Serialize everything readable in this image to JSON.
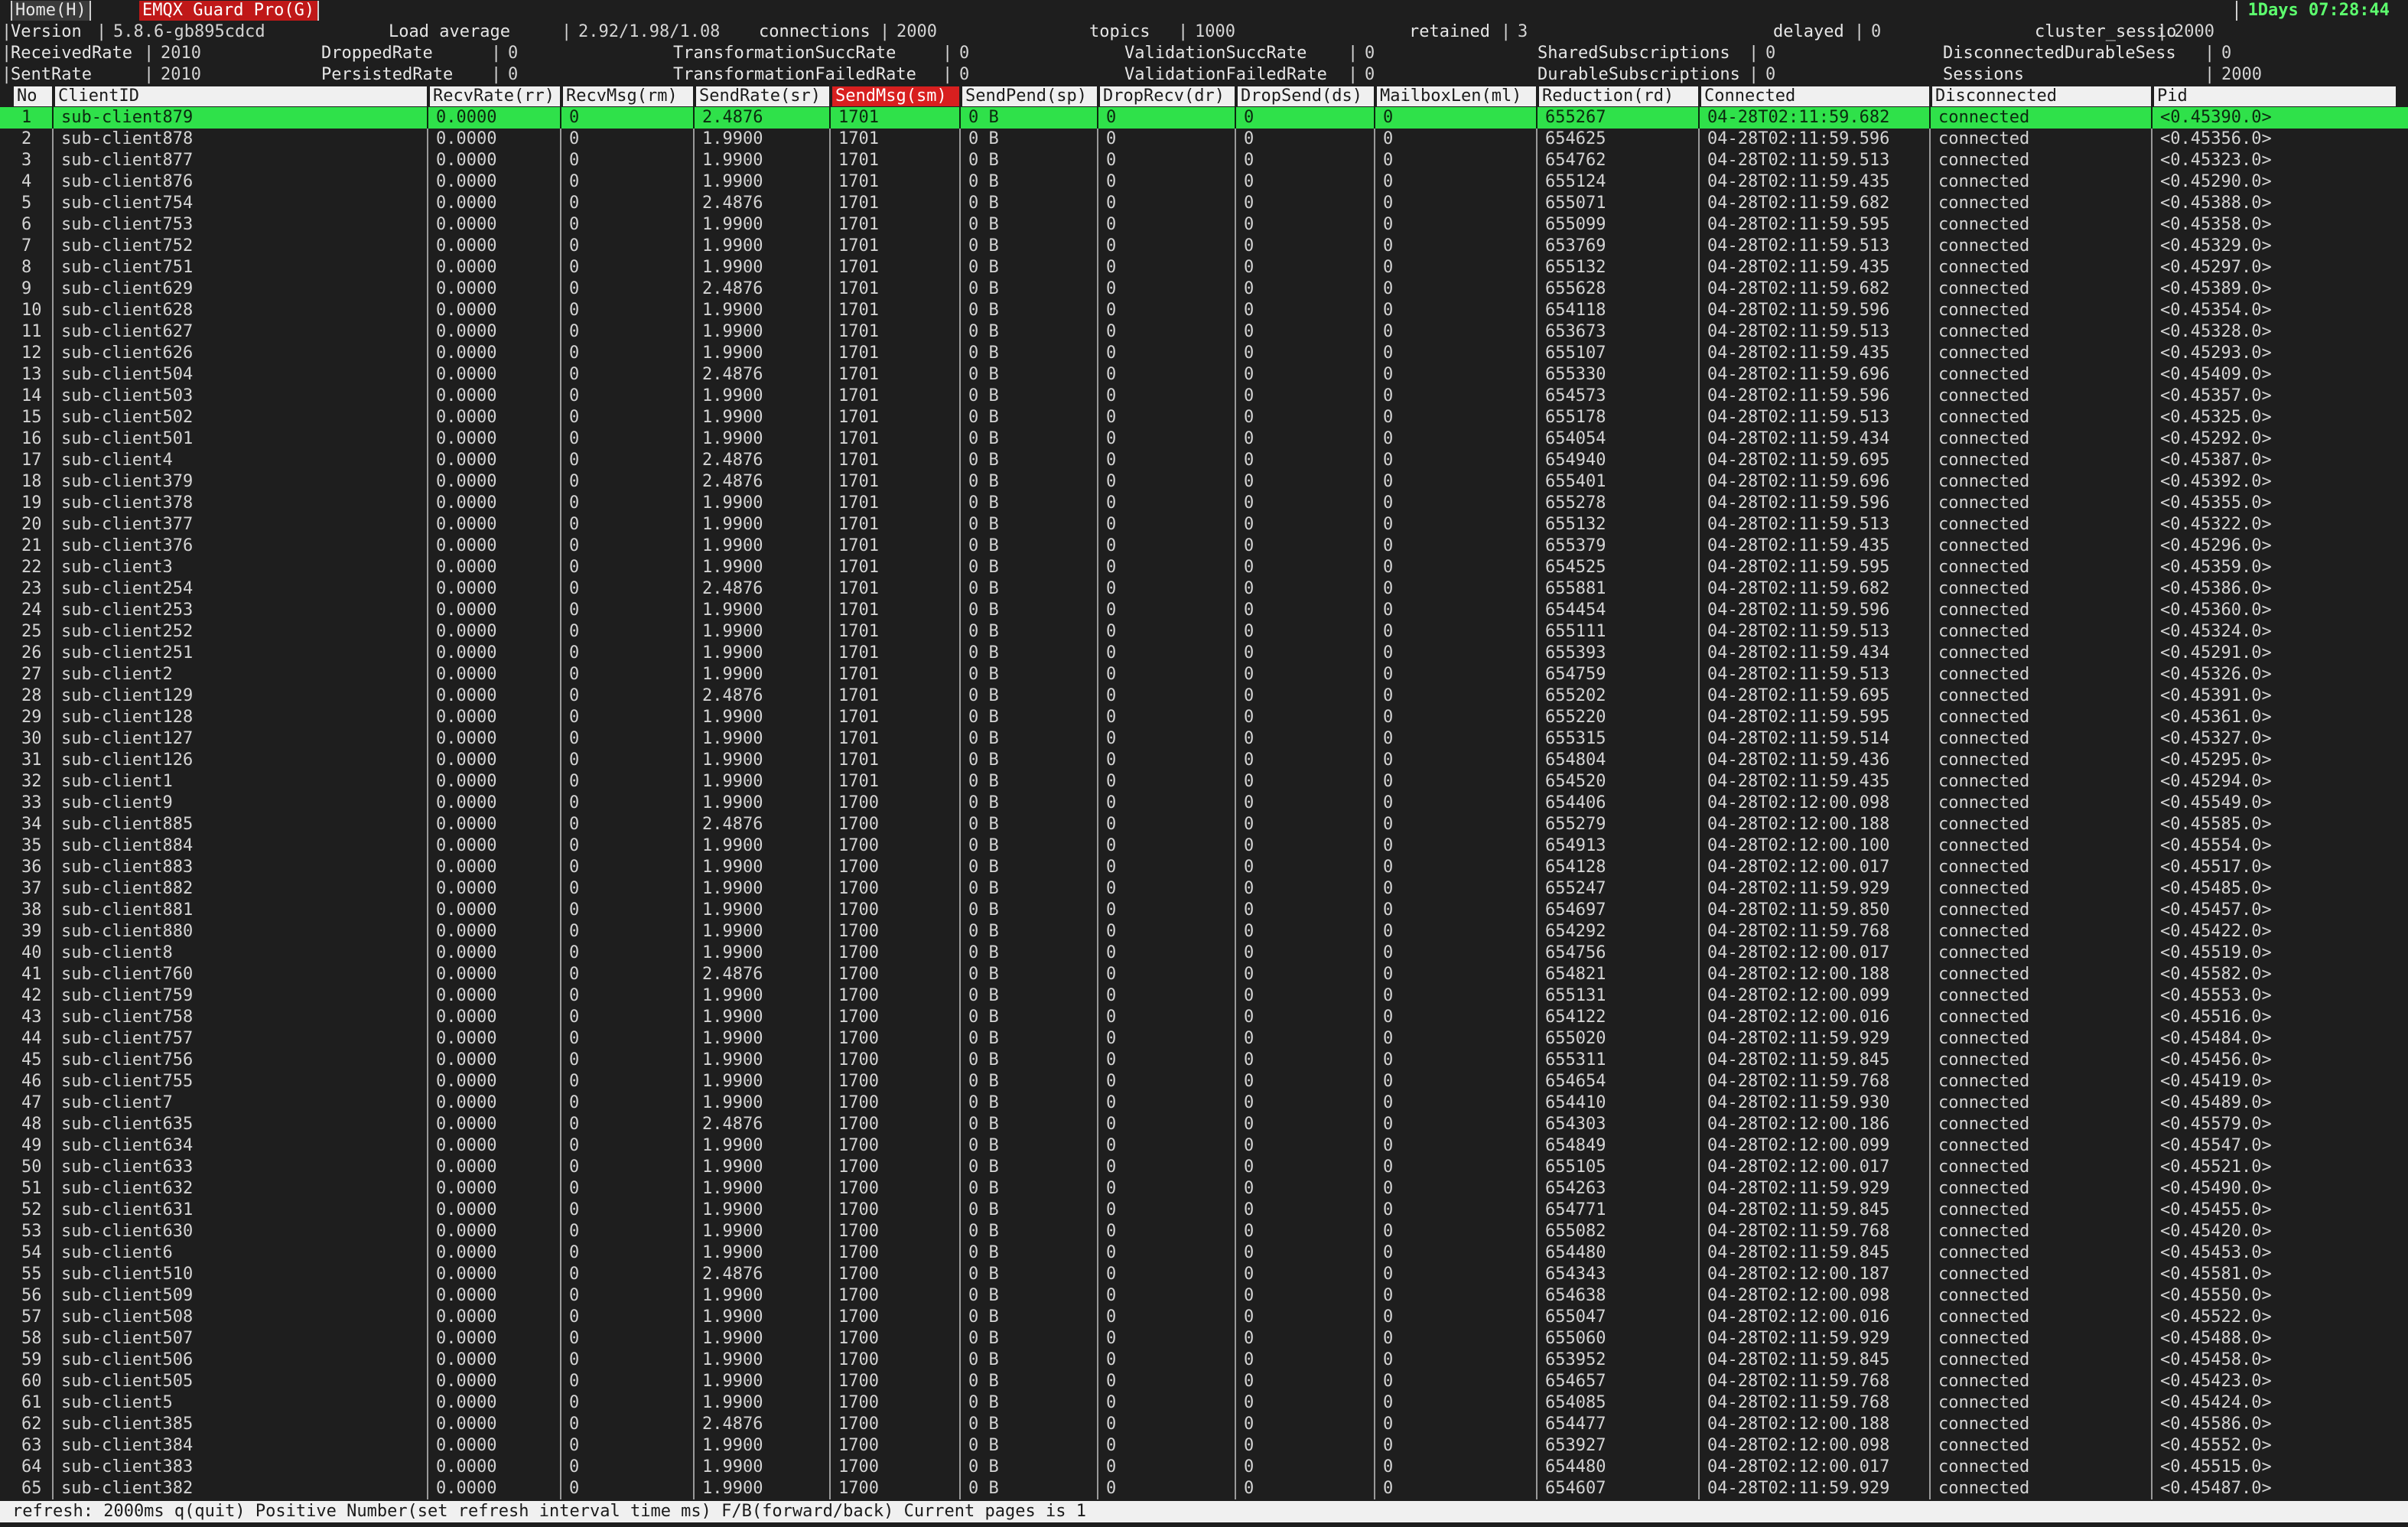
{
  "tabs": [
    {
      "label": "Home(H)"
    },
    {
      "label": "EMQX Guard Pro(G)"
    }
  ],
  "uptime": "1Days 07:28:44",
  "stats_rows": [
    [
      {
        "label": "Version",
        "value": "5.8.6-gb895cdcd"
      },
      {
        "label": "Load average",
        "value": "2.92/1.98/1.08"
      },
      {
        "label": "connections",
        "value": "2000"
      },
      {
        "label": "topics",
        "value": "1000"
      },
      {
        "label": "retained",
        "value": "3"
      },
      {
        "label": "delayed",
        "value": "0"
      },
      {
        "label": "cluster_sessio",
        "value": "2000"
      }
    ],
    [
      {
        "label": "ReceivedRate",
        "value": "2010"
      },
      {
        "label": "DroppedRate",
        "value": "0"
      },
      {
        "label": "TransformationSuccRate",
        "value": "0"
      },
      {
        "label": "ValidationSuccRate",
        "value": "0"
      },
      {
        "label": "SharedSubscriptions",
        "value": "0"
      },
      {
        "label": "DisconnectedDurableSess",
        "value": "0"
      }
    ],
    [
      {
        "label": "SentRate",
        "value": "2010"
      },
      {
        "label": "PersistedRate",
        "value": "0"
      },
      {
        "label": "TransformationFailedRate",
        "value": "0"
      },
      {
        "label": "ValidationFailedRate",
        "value": "0"
      },
      {
        "label": "DurableSubscriptions",
        "value": "0"
      },
      {
        "label": "Sessions",
        "value": "2000"
      }
    ]
  ],
  "columns": [
    "No",
    "ClientID",
    "RecvRate(rr)",
    "RecvMsg(rm)",
    "SendRate(sr)",
    "SendMsg(sm)",
    "SendPend(sp)",
    "DropRecv(dr)",
    "DropSend(ds)",
    "MailboxLen(ml)",
    "Reduction(rd)",
    "Connected",
    "Disconnected",
    "Pid"
  ],
  "sorted_column": "SendMsg(sm)",
  "selected_row": 1,
  "rows": [
    [
      "1",
      "sub-client879",
      "0.0000",
      "0",
      "2.4876",
      "1701",
      "0 B",
      "0",
      "0",
      "0",
      "655267",
      "04-28T02:11:59.682",
      "connected",
      "<0.45390.0>"
    ],
    [
      "2",
      "sub-client878",
      "0.0000",
      "0",
      "1.9900",
      "1701",
      "0 B",
      "0",
      "0",
      "0",
      "654625",
      "04-28T02:11:59.596",
      "connected",
      "<0.45356.0>"
    ],
    [
      "3",
      "sub-client877",
      "0.0000",
      "0",
      "1.9900",
      "1701",
      "0 B",
      "0",
      "0",
      "0",
      "654762",
      "04-28T02:11:59.513",
      "connected",
      "<0.45323.0>"
    ],
    [
      "4",
      "sub-client876",
      "0.0000",
      "0",
      "1.9900",
      "1701",
      "0 B",
      "0",
      "0",
      "0",
      "655124",
      "04-28T02:11:59.435",
      "connected",
      "<0.45290.0>"
    ],
    [
      "5",
      "sub-client754",
      "0.0000",
      "0",
      "2.4876",
      "1701",
      "0 B",
      "0",
      "0",
      "0",
      "655071",
      "04-28T02:11:59.682",
      "connected",
      "<0.45388.0>"
    ],
    [
      "6",
      "sub-client753",
      "0.0000",
      "0",
      "1.9900",
      "1701",
      "0 B",
      "0",
      "0",
      "0",
      "655099",
      "04-28T02:11:59.595",
      "connected",
      "<0.45358.0>"
    ],
    [
      "7",
      "sub-client752",
      "0.0000",
      "0",
      "1.9900",
      "1701",
      "0 B",
      "0",
      "0",
      "0",
      "653769",
      "04-28T02:11:59.513",
      "connected",
      "<0.45329.0>"
    ],
    [
      "8",
      "sub-client751",
      "0.0000",
      "0",
      "1.9900",
      "1701",
      "0 B",
      "0",
      "0",
      "0",
      "655132",
      "04-28T02:11:59.435",
      "connected",
      "<0.45297.0>"
    ],
    [
      "9",
      "sub-client629",
      "0.0000",
      "0",
      "2.4876",
      "1701",
      "0 B",
      "0",
      "0",
      "0",
      "655628",
      "04-28T02:11:59.682",
      "connected",
      "<0.45389.0>"
    ],
    [
      "10",
      "sub-client628",
      "0.0000",
      "0",
      "1.9900",
      "1701",
      "0 B",
      "0",
      "0",
      "0",
      "654118",
      "04-28T02:11:59.596",
      "connected",
      "<0.45354.0>"
    ],
    [
      "11",
      "sub-client627",
      "0.0000",
      "0",
      "1.9900",
      "1701",
      "0 B",
      "0",
      "0",
      "0",
      "653673",
      "04-28T02:11:59.513",
      "connected",
      "<0.45328.0>"
    ],
    [
      "12",
      "sub-client626",
      "0.0000",
      "0",
      "1.9900",
      "1701",
      "0 B",
      "0",
      "0",
      "0",
      "655107",
      "04-28T02:11:59.435",
      "connected",
      "<0.45293.0>"
    ],
    [
      "13",
      "sub-client504",
      "0.0000",
      "0",
      "2.4876",
      "1701",
      "0 B",
      "0",
      "0",
      "0",
      "655330",
      "04-28T02:11:59.696",
      "connected",
      "<0.45409.0>"
    ],
    [
      "14",
      "sub-client503",
      "0.0000",
      "0",
      "1.9900",
      "1701",
      "0 B",
      "0",
      "0",
      "0",
      "654573",
      "04-28T02:11:59.596",
      "connected",
      "<0.45357.0>"
    ],
    [
      "15",
      "sub-client502",
      "0.0000",
      "0",
      "1.9900",
      "1701",
      "0 B",
      "0",
      "0",
      "0",
      "655178",
      "04-28T02:11:59.513",
      "connected",
      "<0.45325.0>"
    ],
    [
      "16",
      "sub-client501",
      "0.0000",
      "0",
      "1.9900",
      "1701",
      "0 B",
      "0",
      "0",
      "0",
      "654054",
      "04-28T02:11:59.434",
      "connected",
      "<0.45292.0>"
    ],
    [
      "17",
      "sub-client4",
      "0.0000",
      "0",
      "2.4876",
      "1701",
      "0 B",
      "0",
      "0",
      "0",
      "654940",
      "04-28T02:11:59.695",
      "connected",
      "<0.45387.0>"
    ],
    [
      "18",
      "sub-client379",
      "0.0000",
      "0",
      "2.4876",
      "1701",
      "0 B",
      "0",
      "0",
      "0",
      "655401",
      "04-28T02:11:59.696",
      "connected",
      "<0.45392.0>"
    ],
    [
      "19",
      "sub-client378",
      "0.0000",
      "0",
      "1.9900",
      "1701",
      "0 B",
      "0",
      "0",
      "0",
      "655278",
      "04-28T02:11:59.596",
      "connected",
      "<0.45355.0>"
    ],
    [
      "20",
      "sub-client377",
      "0.0000",
      "0",
      "1.9900",
      "1701",
      "0 B",
      "0",
      "0",
      "0",
      "655132",
      "04-28T02:11:59.513",
      "connected",
      "<0.45322.0>"
    ],
    [
      "21",
      "sub-client376",
      "0.0000",
      "0",
      "1.9900",
      "1701",
      "0 B",
      "0",
      "0",
      "0",
      "655379",
      "04-28T02:11:59.435",
      "connected",
      "<0.45296.0>"
    ],
    [
      "22",
      "sub-client3",
      "0.0000",
      "0",
      "1.9900",
      "1701",
      "0 B",
      "0",
      "0",
      "0",
      "654525",
      "04-28T02:11:59.595",
      "connected",
      "<0.45359.0>"
    ],
    [
      "23",
      "sub-client254",
      "0.0000",
      "0",
      "2.4876",
      "1701",
      "0 B",
      "0",
      "0",
      "0",
      "655881",
      "04-28T02:11:59.682",
      "connected",
      "<0.45386.0>"
    ],
    [
      "24",
      "sub-client253",
      "0.0000",
      "0",
      "1.9900",
      "1701",
      "0 B",
      "0",
      "0",
      "0",
      "654454",
      "04-28T02:11:59.596",
      "connected",
      "<0.45360.0>"
    ],
    [
      "25",
      "sub-client252",
      "0.0000",
      "0",
      "1.9900",
      "1701",
      "0 B",
      "0",
      "0",
      "0",
      "655111",
      "04-28T02:11:59.513",
      "connected",
      "<0.45324.0>"
    ],
    [
      "26",
      "sub-client251",
      "0.0000",
      "0",
      "1.9900",
      "1701",
      "0 B",
      "0",
      "0",
      "0",
      "655393",
      "04-28T02:11:59.434",
      "connected",
      "<0.45291.0>"
    ],
    [
      "27",
      "sub-client2",
      "0.0000",
      "0",
      "1.9900",
      "1701",
      "0 B",
      "0",
      "0",
      "0",
      "654759",
      "04-28T02:11:59.513",
      "connected",
      "<0.45326.0>"
    ],
    [
      "28",
      "sub-client129",
      "0.0000",
      "0",
      "2.4876",
      "1701",
      "0 B",
      "0",
      "0",
      "0",
      "655202",
      "04-28T02:11:59.695",
      "connected",
      "<0.45391.0>"
    ],
    [
      "29",
      "sub-client128",
      "0.0000",
      "0",
      "1.9900",
      "1701",
      "0 B",
      "0",
      "0",
      "0",
      "655220",
      "04-28T02:11:59.595",
      "connected",
      "<0.45361.0>"
    ],
    [
      "30",
      "sub-client127",
      "0.0000",
      "0",
      "1.9900",
      "1701",
      "0 B",
      "0",
      "0",
      "0",
      "655315",
      "04-28T02:11:59.514",
      "connected",
      "<0.45327.0>"
    ],
    [
      "31",
      "sub-client126",
      "0.0000",
      "0",
      "1.9900",
      "1701",
      "0 B",
      "0",
      "0",
      "0",
      "654804",
      "04-28T02:11:59.436",
      "connected",
      "<0.45295.0>"
    ],
    [
      "32",
      "sub-client1",
      "0.0000",
      "0",
      "1.9900",
      "1701",
      "0 B",
      "0",
      "0",
      "0",
      "654520",
      "04-28T02:11:59.435",
      "connected",
      "<0.45294.0>"
    ],
    [
      "33",
      "sub-client9",
      "0.0000",
      "0",
      "1.9900",
      "1700",
      "0 B",
      "0",
      "0",
      "0",
      "654406",
      "04-28T02:12:00.098",
      "connected",
      "<0.45549.0>"
    ],
    [
      "34",
      "sub-client885",
      "0.0000",
      "0",
      "2.4876",
      "1700",
      "0 B",
      "0",
      "0",
      "0",
      "655279",
      "04-28T02:12:00.188",
      "connected",
      "<0.45585.0>"
    ],
    [
      "35",
      "sub-client884",
      "0.0000",
      "0",
      "1.9900",
      "1700",
      "0 B",
      "0",
      "0",
      "0",
      "654913",
      "04-28T02:12:00.100",
      "connected",
      "<0.45554.0>"
    ],
    [
      "36",
      "sub-client883",
      "0.0000",
      "0",
      "1.9900",
      "1700",
      "0 B",
      "0",
      "0",
      "0",
      "654128",
      "04-28T02:12:00.017",
      "connected",
      "<0.45517.0>"
    ],
    [
      "37",
      "sub-client882",
      "0.0000",
      "0",
      "1.9900",
      "1700",
      "0 B",
      "0",
      "0",
      "0",
      "655247",
      "04-28T02:11:59.929",
      "connected",
      "<0.45485.0>"
    ],
    [
      "38",
      "sub-client881",
      "0.0000",
      "0",
      "1.9900",
      "1700",
      "0 B",
      "0",
      "0",
      "0",
      "654697",
      "04-28T02:11:59.850",
      "connected",
      "<0.45457.0>"
    ],
    [
      "39",
      "sub-client880",
      "0.0000",
      "0",
      "1.9900",
      "1700",
      "0 B",
      "0",
      "0",
      "0",
      "654292",
      "04-28T02:11:59.768",
      "connected",
      "<0.45422.0>"
    ],
    [
      "40",
      "sub-client8",
      "0.0000",
      "0",
      "1.9900",
      "1700",
      "0 B",
      "0",
      "0",
      "0",
      "654756",
      "04-28T02:12:00.017",
      "connected",
      "<0.45519.0>"
    ],
    [
      "41",
      "sub-client760",
      "0.0000",
      "0",
      "2.4876",
      "1700",
      "0 B",
      "0",
      "0",
      "0",
      "654821",
      "04-28T02:12:00.188",
      "connected",
      "<0.45582.0>"
    ],
    [
      "42",
      "sub-client759",
      "0.0000",
      "0",
      "1.9900",
      "1700",
      "0 B",
      "0",
      "0",
      "0",
      "655131",
      "04-28T02:12:00.099",
      "connected",
      "<0.45553.0>"
    ],
    [
      "43",
      "sub-client758",
      "0.0000",
      "0",
      "1.9900",
      "1700",
      "0 B",
      "0",
      "0",
      "0",
      "654122",
      "04-28T02:12:00.016",
      "connected",
      "<0.45516.0>"
    ],
    [
      "44",
      "sub-client757",
      "0.0000",
      "0",
      "1.9900",
      "1700",
      "0 B",
      "0",
      "0",
      "0",
      "655020",
      "04-28T02:11:59.929",
      "connected",
      "<0.45484.0>"
    ],
    [
      "45",
      "sub-client756",
      "0.0000",
      "0",
      "1.9900",
      "1700",
      "0 B",
      "0",
      "0",
      "0",
      "655311",
      "04-28T02:11:59.845",
      "connected",
      "<0.45456.0>"
    ],
    [
      "46",
      "sub-client755",
      "0.0000",
      "0",
      "1.9900",
      "1700",
      "0 B",
      "0",
      "0",
      "0",
      "654654",
      "04-28T02:11:59.768",
      "connected",
      "<0.45419.0>"
    ],
    [
      "47",
      "sub-client7",
      "0.0000",
      "0",
      "1.9900",
      "1700",
      "0 B",
      "0",
      "0",
      "0",
      "654410",
      "04-28T02:11:59.930",
      "connected",
      "<0.45489.0>"
    ],
    [
      "48",
      "sub-client635",
      "0.0000",
      "0",
      "2.4876",
      "1700",
      "0 B",
      "0",
      "0",
      "0",
      "654303",
      "04-28T02:12:00.186",
      "connected",
      "<0.45579.0>"
    ],
    [
      "49",
      "sub-client634",
      "0.0000",
      "0",
      "1.9900",
      "1700",
      "0 B",
      "0",
      "0",
      "0",
      "654849",
      "04-28T02:12:00.099",
      "connected",
      "<0.45547.0>"
    ],
    [
      "50",
      "sub-client633",
      "0.0000",
      "0",
      "1.9900",
      "1700",
      "0 B",
      "0",
      "0",
      "0",
      "655105",
      "04-28T02:12:00.017",
      "connected",
      "<0.45521.0>"
    ],
    [
      "51",
      "sub-client632",
      "0.0000",
      "0",
      "1.9900",
      "1700",
      "0 B",
      "0",
      "0",
      "0",
      "654263",
      "04-28T02:11:59.929",
      "connected",
      "<0.45490.0>"
    ],
    [
      "52",
      "sub-client631",
      "0.0000",
      "0",
      "1.9900",
      "1700",
      "0 B",
      "0",
      "0",
      "0",
      "654771",
      "04-28T02:11:59.845",
      "connected",
      "<0.45455.0>"
    ],
    [
      "53",
      "sub-client630",
      "0.0000",
      "0",
      "1.9900",
      "1700",
      "0 B",
      "0",
      "0",
      "0",
      "655082",
      "04-28T02:11:59.768",
      "connected",
      "<0.45420.0>"
    ],
    [
      "54",
      "sub-client6",
      "0.0000",
      "0",
      "1.9900",
      "1700",
      "0 B",
      "0",
      "0",
      "0",
      "654480",
      "04-28T02:11:59.845",
      "connected",
      "<0.45453.0>"
    ],
    [
      "55",
      "sub-client510",
      "0.0000",
      "0",
      "2.4876",
      "1700",
      "0 B",
      "0",
      "0",
      "0",
      "654343",
      "04-28T02:12:00.187",
      "connected",
      "<0.45581.0>"
    ],
    [
      "56",
      "sub-client509",
      "0.0000",
      "0",
      "1.9900",
      "1700",
      "0 B",
      "0",
      "0",
      "0",
      "654638",
      "04-28T02:12:00.098",
      "connected",
      "<0.45550.0>"
    ],
    [
      "57",
      "sub-client508",
      "0.0000",
      "0",
      "1.9900",
      "1700",
      "0 B",
      "0",
      "0",
      "0",
      "655047",
      "04-28T02:12:00.016",
      "connected",
      "<0.45522.0>"
    ],
    [
      "58",
      "sub-client507",
      "0.0000",
      "0",
      "1.9900",
      "1700",
      "0 B",
      "0",
      "0",
      "0",
      "655060",
      "04-28T02:11:59.929",
      "connected",
      "<0.45488.0>"
    ],
    [
      "59",
      "sub-client506",
      "0.0000",
      "0",
      "1.9900",
      "1700",
      "0 B",
      "0",
      "0",
      "0",
      "653952",
      "04-28T02:11:59.845",
      "connected",
      "<0.45458.0>"
    ],
    [
      "60",
      "sub-client505",
      "0.0000",
      "0",
      "1.9900",
      "1700",
      "0 B",
      "0",
      "0",
      "0",
      "654657",
      "04-28T02:11:59.768",
      "connected",
      "<0.45423.0>"
    ],
    [
      "61",
      "sub-client5",
      "0.0000",
      "0",
      "1.9900",
      "1700",
      "0 B",
      "0",
      "0",
      "0",
      "654085",
      "04-28T02:11:59.768",
      "connected",
      "<0.45424.0>"
    ],
    [
      "62",
      "sub-client385",
      "0.0000",
      "0",
      "2.4876",
      "1700",
      "0 B",
      "0",
      "0",
      "0",
      "654477",
      "04-28T02:12:00.188",
      "connected",
      "<0.45586.0>"
    ],
    [
      "63",
      "sub-client384",
      "0.0000",
      "0",
      "1.9900",
      "1700",
      "0 B",
      "0",
      "0",
      "0",
      "653927",
      "04-28T02:12:00.098",
      "connected",
      "<0.45552.0>"
    ],
    [
      "64",
      "sub-client383",
      "0.0000",
      "0",
      "1.9900",
      "1700",
      "0 B",
      "0",
      "0",
      "0",
      "654480",
      "04-28T02:12:00.017",
      "connected",
      "<0.45515.0>"
    ],
    [
      "65",
      "sub-client382",
      "0.0000",
      "0",
      "1.9900",
      "1700",
      "0 B",
      "0",
      "0",
      "0",
      "654607",
      "04-28T02:11:59.929",
      "connected",
      "<0.45487.0>"
    ]
  ],
  "footer": "refresh: 2000ms q(quit) Positive Number(set refresh interval time ms) F/B(forward/back) Current pages is 1",
  "colors": {
    "selected_row": "#2fe14a",
    "sorted_header": "#d81f1f",
    "uptime": "#5dff6e",
    "tab_active": "#c01818"
  }
}
